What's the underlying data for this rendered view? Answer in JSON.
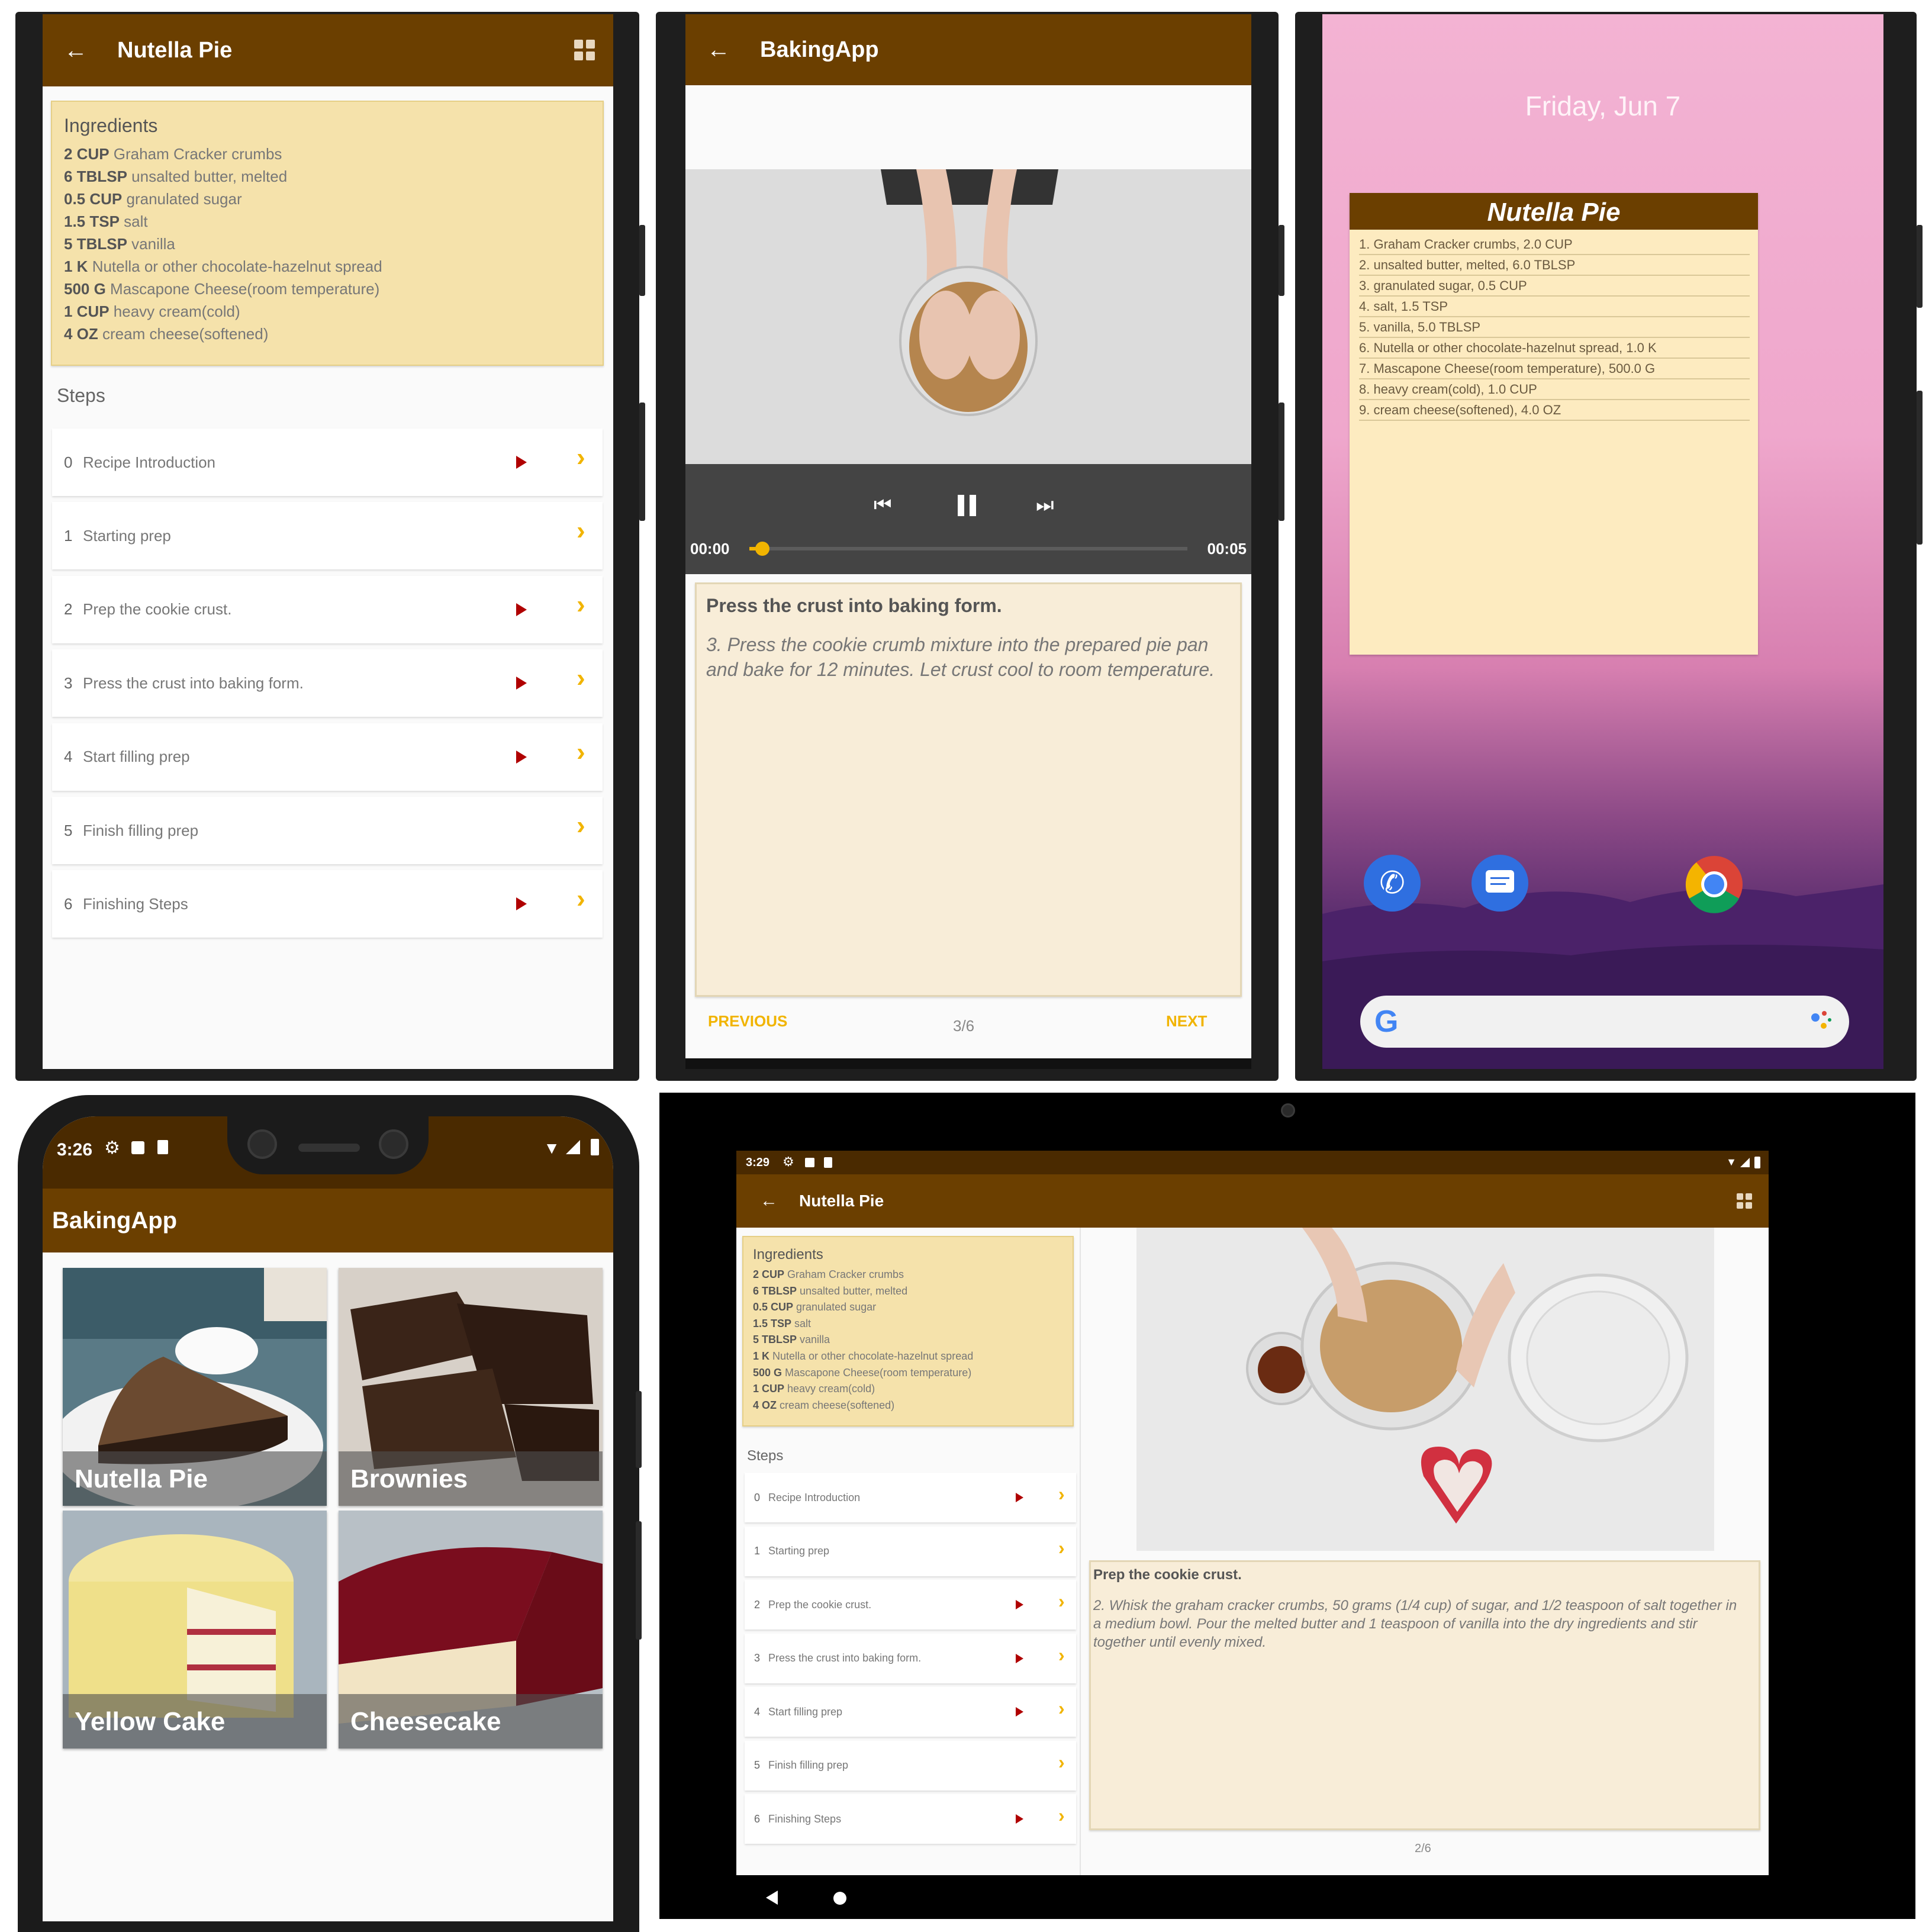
{
  "panel1": {
    "title": "Nutella Pie",
    "back_icon": "arrow-back-icon",
    "widget_icon": "widget-icon",
    "ingredients_title": "Ingredients",
    "ingredients": [
      {
        "qty": "2 CUP",
        "name": "Graham Cracker crumbs"
      },
      {
        "qty": "6 TBLSP",
        "name": "unsalted butter, melted"
      },
      {
        "qty": "0.5 CUP",
        "name": "granulated sugar"
      },
      {
        "qty": "1.5 TSP",
        "name": "salt"
      },
      {
        "qty": "5 TBLSP",
        "name": "vanilla"
      },
      {
        "qty": "1 K",
        "name": "Nutella or other chocolate-hazelnut spread"
      },
      {
        "qty": "500 G",
        "name": "Mascapone Cheese(room temperature)"
      },
      {
        "qty": "1 CUP",
        "name": "heavy cream(cold)"
      },
      {
        "qty": "4 OZ",
        "name": "cream cheese(softened)"
      }
    ],
    "steps_title": "Steps",
    "steps": [
      {
        "num": "0",
        "label": "Recipe Introduction",
        "has_video": true
      },
      {
        "num": "1",
        "label": "Starting prep",
        "has_video": false
      },
      {
        "num": "2",
        "label": "Prep the cookie crust.",
        "has_video": true
      },
      {
        "num": "3",
        "label": "Press the crust into baking form.",
        "has_video": true
      },
      {
        "num": "4",
        "label": "Start filling prep",
        "has_video": true
      },
      {
        "num": "5",
        "label": "Finish filling prep",
        "has_video": false
      },
      {
        "num": "6",
        "label": "Finishing Steps",
        "has_video": true
      }
    ],
    "chevron": "›"
  },
  "panel2": {
    "title": "BakingApp",
    "time_start": "00:00",
    "time_end": "00:05",
    "progress_fraction": 0.03,
    "step_title": "Press the crust into baking form.",
    "step_desc": "3. Press the cookie crumb mixture into the prepared pie pan and bake for 12 minutes. Let crust cool to room temperature.",
    "prev_label": "PREVIOUS",
    "next_label": "NEXT",
    "page_indicator": "3/6"
  },
  "panel3": {
    "date": "Friday, Jun 7",
    "widget_title": "Nutella Pie",
    "widget_items": [
      "1. Graham Cracker crumbs, 2.0 CUP",
      "2. unsalted butter, melted, 6.0 TBLSP",
      "3. granulated sugar, 0.5 CUP",
      "4. salt, 1.5 TSP",
      "5. vanilla, 5.0 TBLSP",
      "6. Nutella or other chocolate-hazelnut spread, 1.0 K",
      "7. Mascapone Cheese(room temperature), 500.0 G",
      "8. heavy cream(cold), 1.0 CUP",
      "9. cream cheese(softened), 4.0 OZ"
    ],
    "search_logo": "G"
  },
  "panel4": {
    "time": "3:26",
    "title": "BakingApp",
    "recipes": [
      "Nutella Pie",
      "Brownies",
      "Yellow Cake",
      "Cheesecake"
    ]
  },
  "panel5": {
    "time": "3:29",
    "title": "Nutella Pie",
    "ingredients_title": "Ingredients",
    "steps_title": "Steps",
    "step_title": "Prep the cookie crust.",
    "step_desc": "2. Whisk the graham cracker crumbs, 50 grams (1/4 cup) of sugar, and 1/2 teaspoon of salt together in a medium bowl. Pour the melted butter and 1 teaspoon of vanilla into the dry ingredients and stir together until evenly mixed.",
    "page_indicator": "2/6"
  },
  "colors": {
    "app_bar": "#6b3f00",
    "ingredients_bg": "#f5e2ab",
    "accent": "#f1b400",
    "play": "#b00000",
    "card_bg": "#f8edd8"
  }
}
